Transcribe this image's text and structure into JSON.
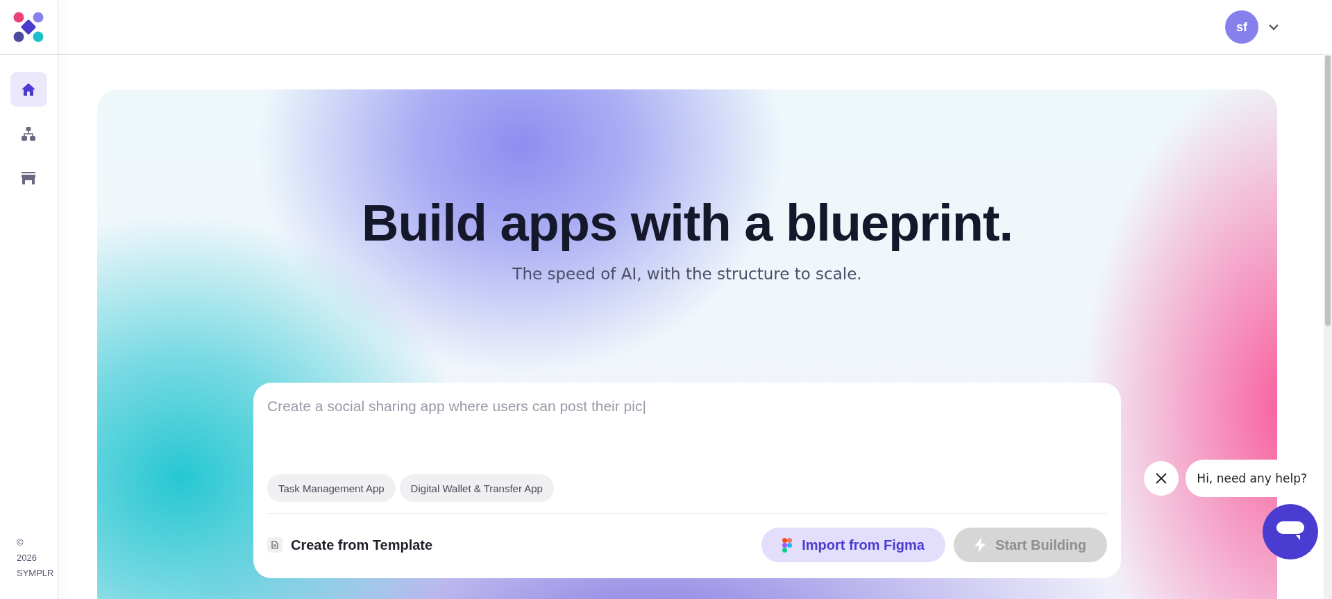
{
  "sidebar": {
    "items": [
      {
        "kind": "home",
        "selected": true
      },
      {
        "kind": "hierarchy",
        "selected": false
      },
      {
        "kind": "store",
        "selected": false
      }
    ],
    "footer": [
      "©",
      "2026",
      "SYMPLR"
    ]
  },
  "header": {
    "avatar": "sf"
  },
  "hero": {
    "title": "Build apps with a blueprint.",
    "subtitle": "The speed of AI, with the structure to scale."
  },
  "prompt": {
    "placeholder": "Create a social sharing app where users can post their pic|",
    "suggestions": [
      "Task Management App",
      "Digital Wallet & Transfer App"
    ],
    "template_link": "Create from Template",
    "buttons": [
      {
        "kind": "figma",
        "label": "Import from Figma",
        "disabled": false
      },
      {
        "kind": "build",
        "label": "Start Building",
        "disabled": true
      }
    ]
  },
  "chat": {
    "message": "Hi, need any help?"
  }
}
